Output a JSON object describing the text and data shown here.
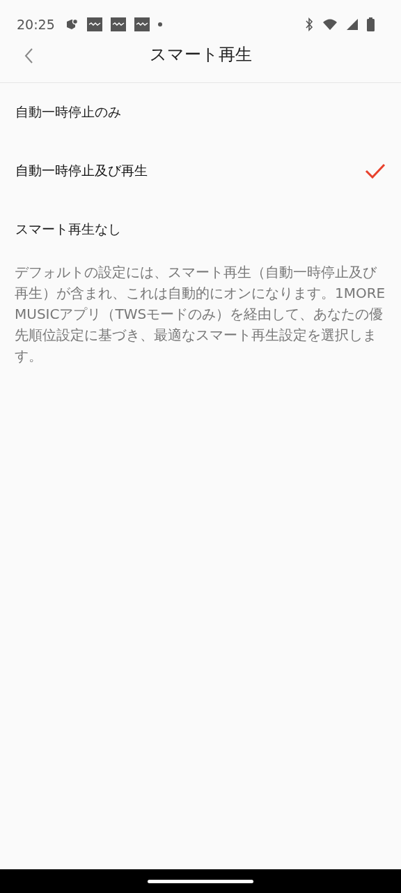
{
  "status_bar": {
    "time": "20:25"
  },
  "header": {
    "title": "スマート再生"
  },
  "options": [
    {
      "label": "自動一時停止のみ",
      "selected": false
    },
    {
      "label": "自動一時停止及び再生",
      "selected": true
    },
    {
      "label": "スマート再生なし",
      "selected": false
    }
  ],
  "description": "デフォルトの設定には、スマート再生（自動一時停止及び再生）が含まれ、これは自動的にオンになります。1MORE MUSICアプリ（TWSモードのみ）を経由して、あなたの優先順位設定に基づき、最適なスマート再生設定を選択します。"
}
